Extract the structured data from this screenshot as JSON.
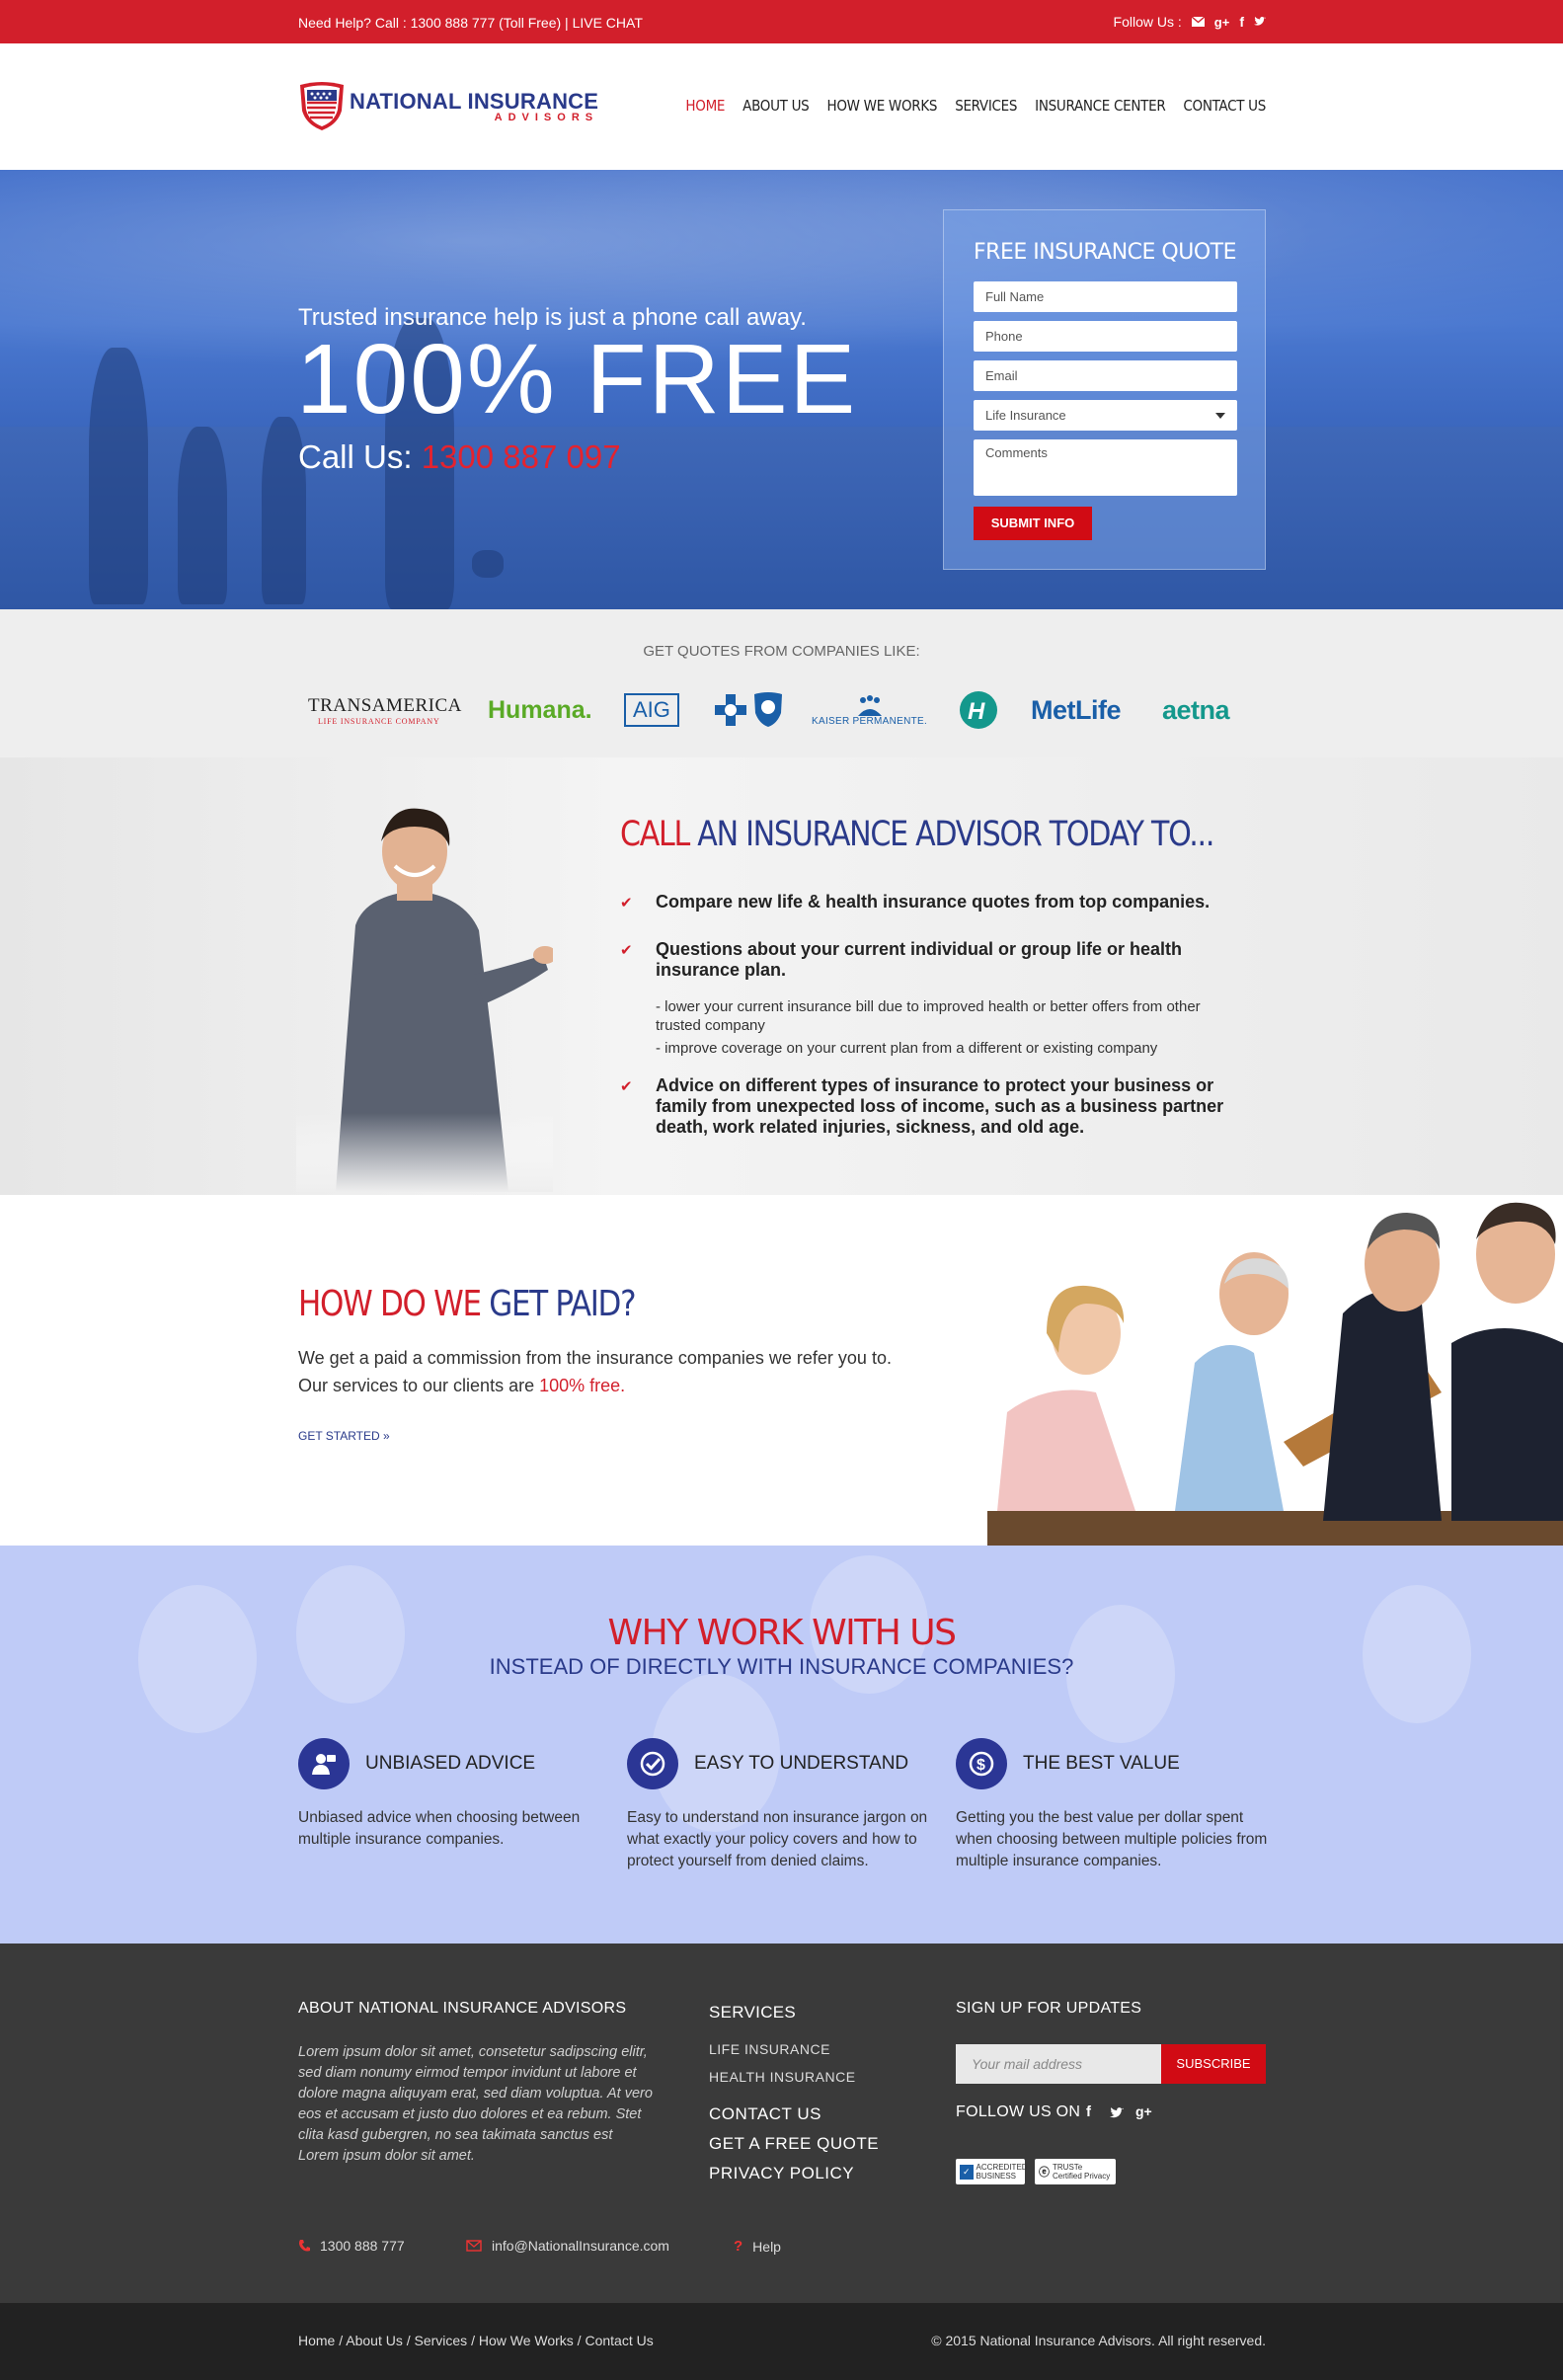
{
  "topbar": {
    "help_text": "Need Help? Call : 1300 888 777 (Toll Free) | LIVE CHAT",
    "follow_label": "Follow Us :"
  },
  "brand": {
    "name": "NATIONAL INSURANCE",
    "sub": "ADVISORS"
  },
  "nav": {
    "items": [
      "HOME",
      "ABOUT US",
      "HOW WE WORKS",
      "SERVICES",
      "INSURANCE CENTER",
      "CONTACT US"
    ],
    "active": "HOME"
  },
  "hero": {
    "tagline": "Trusted insurance help is just a phone call away.",
    "headline": "100% FREE",
    "call_label": "Call Us:",
    "call_number": "1300 887 097"
  },
  "quote_form": {
    "title": "FREE INSURANCE QUOTE",
    "full_name_placeholder": "Full Name",
    "phone_placeholder": "Phone",
    "email_placeholder": "Email",
    "insurance_type_selected": "Life Insurance",
    "comments_placeholder": "Comments",
    "submit_label": "SUBMIT INFO"
  },
  "companies": {
    "label": "GET QUOTES FROM COMPANIES LIKE:",
    "logos": [
      "TRANSAMERICA",
      "LIFE INSURANCE COMPANY",
      "Humana.",
      "AIG",
      "KAISER PERMANENTE.",
      "H",
      "MetLife",
      "aetna"
    ]
  },
  "advisor": {
    "title_red": "CALL",
    "title_rest": "AN INSURANCE ADVISOR TODAY TO...",
    "bullet_1": "Compare new life & health insurance quotes from top companies.",
    "bullet_2": "Questions about your current individual or group life or health insurance plan.",
    "sub_1": "- lower your current insurance bill due to improved health or better offers from other trusted company",
    "sub_2": "- improve coverage on your current plan from a different or existing company",
    "bullet_3": "Advice on different types of insurance to protect your business or family from unexpected loss of income, such as a business partner death, work related injuries, sickness, and old age."
  },
  "paid": {
    "title_red": "HOW DO WE",
    "title_rest": "GET PAID?",
    "line_1": "We get a paid a commission from the insurance companies we refer you to.",
    "line_2_prefix": "Our services to our clients are",
    "line_2_highlight": "100% free.",
    "cta": "GET STARTED »"
  },
  "why": {
    "title": "WHY WORK WITH US",
    "subtitle": "INSTEAD OF DIRECTLY WITH INSURANCE COMPANIES?",
    "features": [
      {
        "title": "UNBIASED ADVICE",
        "desc": "Unbiased advice when choosing between multiple insurance companies.",
        "icon": "advisor-icon"
      },
      {
        "title": "EASY TO UNDERSTAND",
        "desc": "Easy to understand non insurance jargon on what exactly your policy covers and how to protect yourself from denied claims.",
        "icon": "check-icon"
      },
      {
        "title": "THE BEST VALUE",
        "desc": "Getting you the best value per dollar spent when choosing between multiple policies from multiple insurance companies.",
        "icon": "dollar-icon"
      }
    ]
  },
  "footer": {
    "about_title": "ABOUT NATIONAL INSURANCE ADVISORS",
    "about_text": "Lorem ipsum dolor sit amet, consetetur sadipscing elitr, sed diam nonumy eirmod tempor invidunt ut labore et dolore magna aliquyam erat, sed diam voluptua. At vero eos et accusam et justo duo dolores et ea rebum. Stet clita kasd gubergren, no sea takimata sanctus est Lorem ipsum dolor sit amet.",
    "services_title": "SERVICES",
    "service_1": "LIFE INSURANCE",
    "service_2": "HEALTH INSURANCE",
    "link_contact": "CONTACT US",
    "link_quote": "GET A FREE QUOTE",
    "link_privacy": "PRIVACY POLICY",
    "signup_title": "SIGN UP FOR UPDATES",
    "mail_placeholder": "Your mail address",
    "subscribe_label": "SUBSCRIBE",
    "follow_title": "FOLLOW US ON",
    "badge_1": "ACCREDITED BUSINESS",
    "badge_2": "TRUSTe Certified Privacy",
    "phone": "1300 888 777",
    "email": "info@NationalInsurance.com",
    "help": "Help"
  },
  "bottombar": {
    "breadcrumb": "Home / About Us / Services / How We Works / Contact Us",
    "copyright": "© 2015 National Insurance Advisors. All right reserved."
  },
  "colors": {
    "brand_red": "#d21f2b",
    "brand_blue": "#2a3a8a",
    "footer_bg": "#3a3a3a"
  }
}
